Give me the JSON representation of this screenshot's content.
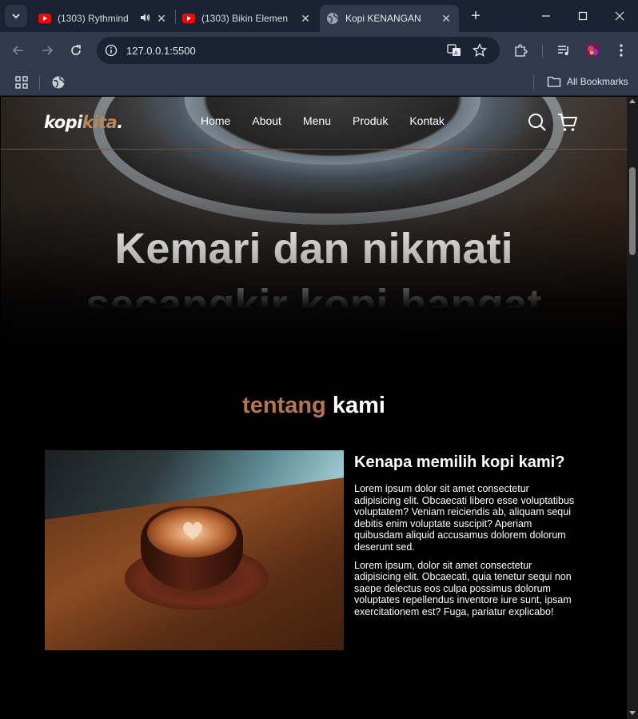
{
  "browser": {
    "tabs": [
      {
        "title": "(1303) Rythmind",
        "favicon": "youtube-icon",
        "audio": true
      },
      {
        "title": "(1303) Bikin Elemen",
        "favicon": "youtube-icon",
        "audio": false
      },
      {
        "title": "Kopi KENANGAN",
        "favicon": "globe-icon",
        "active": true
      }
    ],
    "url": "127.0.0.1:5500",
    "bookmarks_label": "All Bookmarks"
  },
  "site": {
    "logo": {
      "part1": "kopi",
      "part2": "kita",
      "suffix": "."
    },
    "nav": [
      "Home",
      "About",
      "Menu",
      "Produk",
      "Kontak"
    ],
    "hero": {
      "line1": "Kemari dan nikmati",
      "line2": "secangkir kopi hangat"
    },
    "about": {
      "heading_accent": "tentang",
      "heading_plain": "kami",
      "subheading": "Kenapa memilih kopi kami?",
      "paragraphs": [
        "Lorem ipsum dolor sit amet consectetur adipisicing elit. Obcaecati libero esse voluptatibus voluptatem? Veniam reiciendis ab, aliquam sequi debitis enim voluptate suscipit? Aperiam quibusdam aliquid accusamus dolorem dolorum deserunt sed.",
        "Lorem ipsum, dolor sit amet consectetur adipisicing elit. Obcaecati, quia tenetur sequi non saepe delectus eos culpa possimus dolorum voluptates repellendus inventore iure sunt, ipsam exercitationem est? Fuga, pariatur explicabo!"
      ]
    }
  },
  "colors": {
    "accent": "#b6764a",
    "logo_accent": "#b6895b",
    "chrome_dark": "#1b2333",
    "chrome": "#2f3a4d"
  }
}
